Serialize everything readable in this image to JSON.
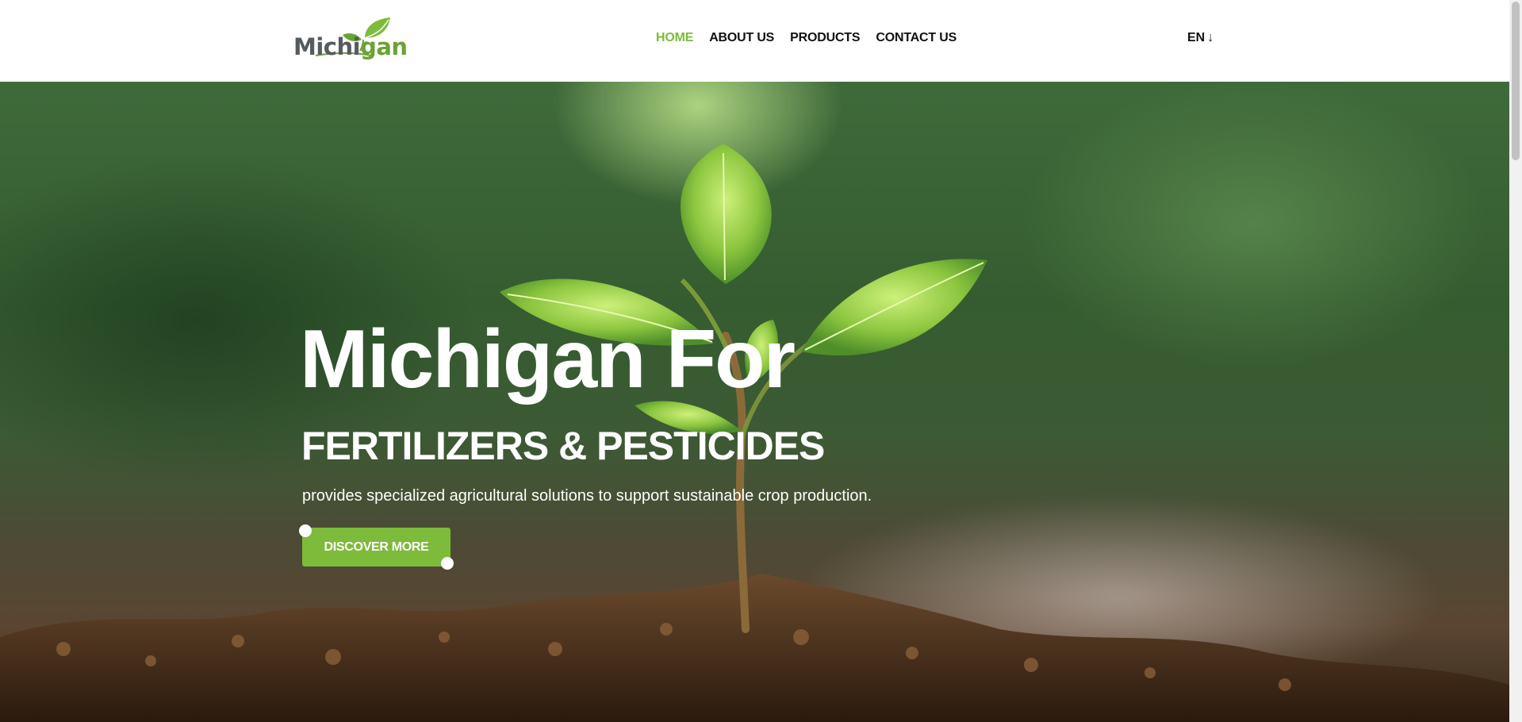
{
  "header": {
    "logo": {
      "text_main": "Michi",
      "text_accent": "gan",
      "icon": "leaf-icon"
    },
    "nav": [
      {
        "label": "HOME",
        "active": true
      },
      {
        "label": "ABOUT US",
        "active": false
      },
      {
        "label": "PRODUCTS",
        "active": false
      },
      {
        "label": "CONTACT US",
        "active": false
      }
    ],
    "language": {
      "label": "EN",
      "icon": "arrow-down-icon",
      "glyph": "↓"
    }
  },
  "hero": {
    "title": "Michigan For",
    "subtitle": "FERTILIZERS & PESTICIDES",
    "description": "provides specialized agricultural solutions to support sustainable crop production.",
    "cta_label": "DISCOVER MORE",
    "background": "seedling-in-soil-image"
  },
  "colors": {
    "accent": "#7dbb3b",
    "nav_text": "#111111",
    "logo_gray": "#555b5e",
    "logo_green": "#6aa335",
    "hero_text": "#ffffff"
  }
}
